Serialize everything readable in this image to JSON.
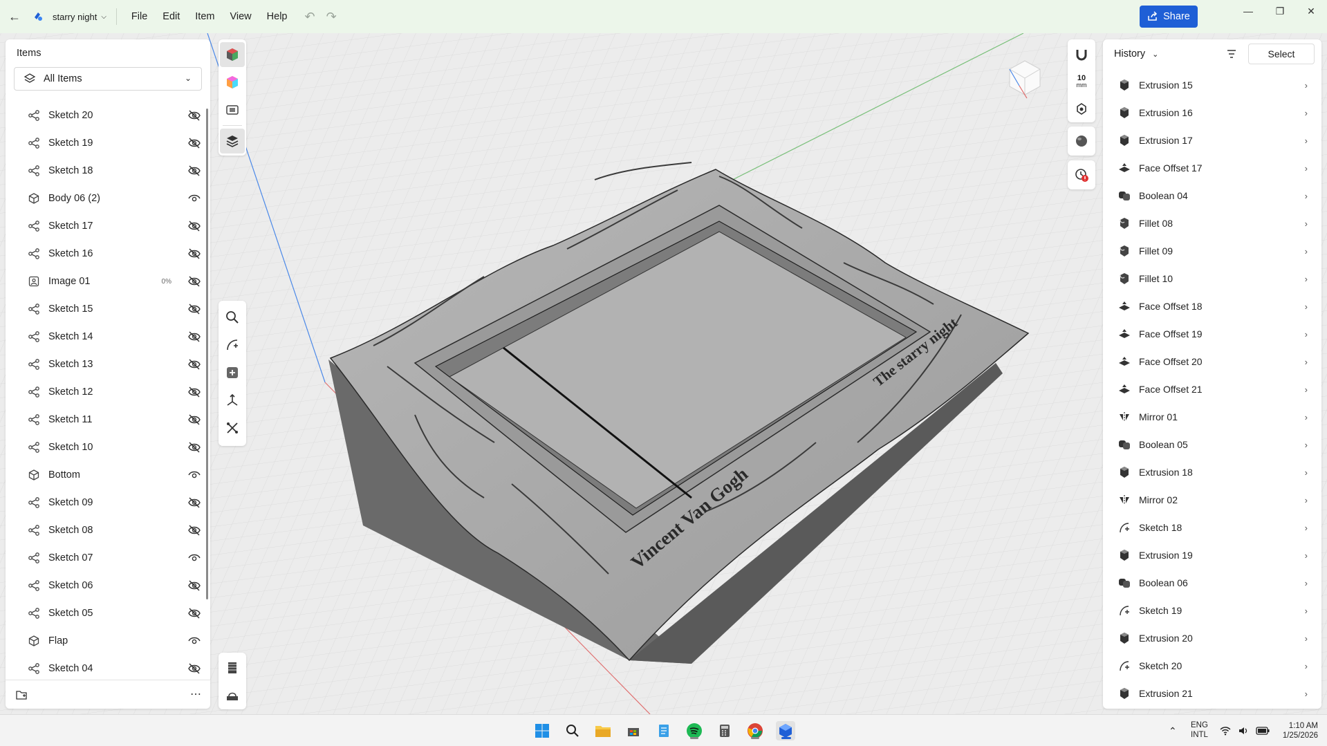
{
  "titlebar": {
    "document_name": "starry night",
    "menu": [
      "File",
      "Edit",
      "Item",
      "View",
      "Help"
    ],
    "share_label": "Share"
  },
  "items_panel": {
    "title": "Items",
    "filter_label": "All Items",
    "items": [
      {
        "label": "Sketch 20",
        "type": "sketch",
        "visible": false
      },
      {
        "label": "Sketch 19",
        "type": "sketch",
        "visible": false
      },
      {
        "label": "Sketch 18",
        "type": "sketch",
        "visible": false
      },
      {
        "label": "Body 06 (2)",
        "type": "body",
        "visible": true
      },
      {
        "label": "Sketch 17",
        "type": "sketch",
        "visible": false
      },
      {
        "label": "Sketch 16",
        "type": "sketch",
        "visible": false
      },
      {
        "label": "Image 01",
        "type": "image",
        "visible": false,
        "percent": "0%"
      },
      {
        "label": "Sketch 15",
        "type": "sketch",
        "visible": false
      },
      {
        "label": "Sketch 14",
        "type": "sketch",
        "visible": false
      },
      {
        "label": "Sketch 13",
        "type": "sketch",
        "visible": false
      },
      {
        "label": "Sketch 12",
        "type": "sketch",
        "visible": false
      },
      {
        "label": "Sketch 11",
        "type": "sketch",
        "visible": false
      },
      {
        "label": "Sketch 10",
        "type": "sketch",
        "visible": false
      },
      {
        "label": "Bottom",
        "type": "body",
        "visible": true
      },
      {
        "label": "Sketch 09",
        "type": "sketch",
        "visible": false
      },
      {
        "label": "Sketch 08",
        "type": "sketch",
        "visible": false
      },
      {
        "label": "Sketch 07",
        "type": "sketch",
        "visible": true
      },
      {
        "label": "Sketch 06",
        "type": "sketch",
        "visible": false
      },
      {
        "label": "Sketch 05",
        "type": "sketch",
        "visible": false
      },
      {
        "label": "Flap",
        "type": "body",
        "visible": true
      },
      {
        "label": "Sketch 04",
        "type": "sketch",
        "visible": false
      }
    ]
  },
  "viewport": {
    "units_label": "10",
    "units_sub": "mm",
    "engraving_1": "Vincent Van Gogh",
    "engraving_2": "The starry night"
  },
  "history_panel": {
    "title": "History",
    "select_label": "Select",
    "items": [
      {
        "label": "Extrusion 15",
        "type": "extrusion"
      },
      {
        "label": "Extrusion 16",
        "type": "extrusion"
      },
      {
        "label": "Extrusion 17",
        "type": "extrusion"
      },
      {
        "label": "Face Offset 17",
        "type": "offset"
      },
      {
        "label": "Boolean 04",
        "type": "boolean"
      },
      {
        "label": "Fillet 08",
        "type": "fillet"
      },
      {
        "label": "Fillet 09",
        "type": "fillet"
      },
      {
        "label": "Fillet 10",
        "type": "fillet"
      },
      {
        "label": "Face Offset 18",
        "type": "offset"
      },
      {
        "label": "Face Offset 19",
        "type": "offset"
      },
      {
        "label": "Face Offset 20",
        "type": "offset"
      },
      {
        "label": "Face Offset 21",
        "type": "offset"
      },
      {
        "label": "Mirror 01",
        "type": "mirror"
      },
      {
        "label": "Boolean 05",
        "type": "boolean"
      },
      {
        "label": "Extrusion 18",
        "type": "extrusion"
      },
      {
        "label": "Mirror 02",
        "type": "mirror"
      },
      {
        "label": "Sketch 18",
        "type": "sketch"
      },
      {
        "label": "Extrusion 19",
        "type": "extrusion"
      },
      {
        "label": "Boolean 06",
        "type": "boolean"
      },
      {
        "label": "Sketch 19",
        "type": "sketch"
      },
      {
        "label": "Extrusion 20",
        "type": "extrusion"
      },
      {
        "label": "Sketch 20",
        "type": "sketch"
      },
      {
        "label": "Extrusion 21",
        "type": "extrusion"
      }
    ]
  },
  "taskbar": {
    "lang_1": "ENG",
    "lang_2": "INTL",
    "time": "1:10 AM",
    "date": "1/25/2026"
  },
  "colors": {
    "accent": "#1f5fd6",
    "titlebar_bg": "#ecf6ea",
    "viewport_bg": "#ebebeb",
    "model_gray": "#a9a9a9"
  }
}
